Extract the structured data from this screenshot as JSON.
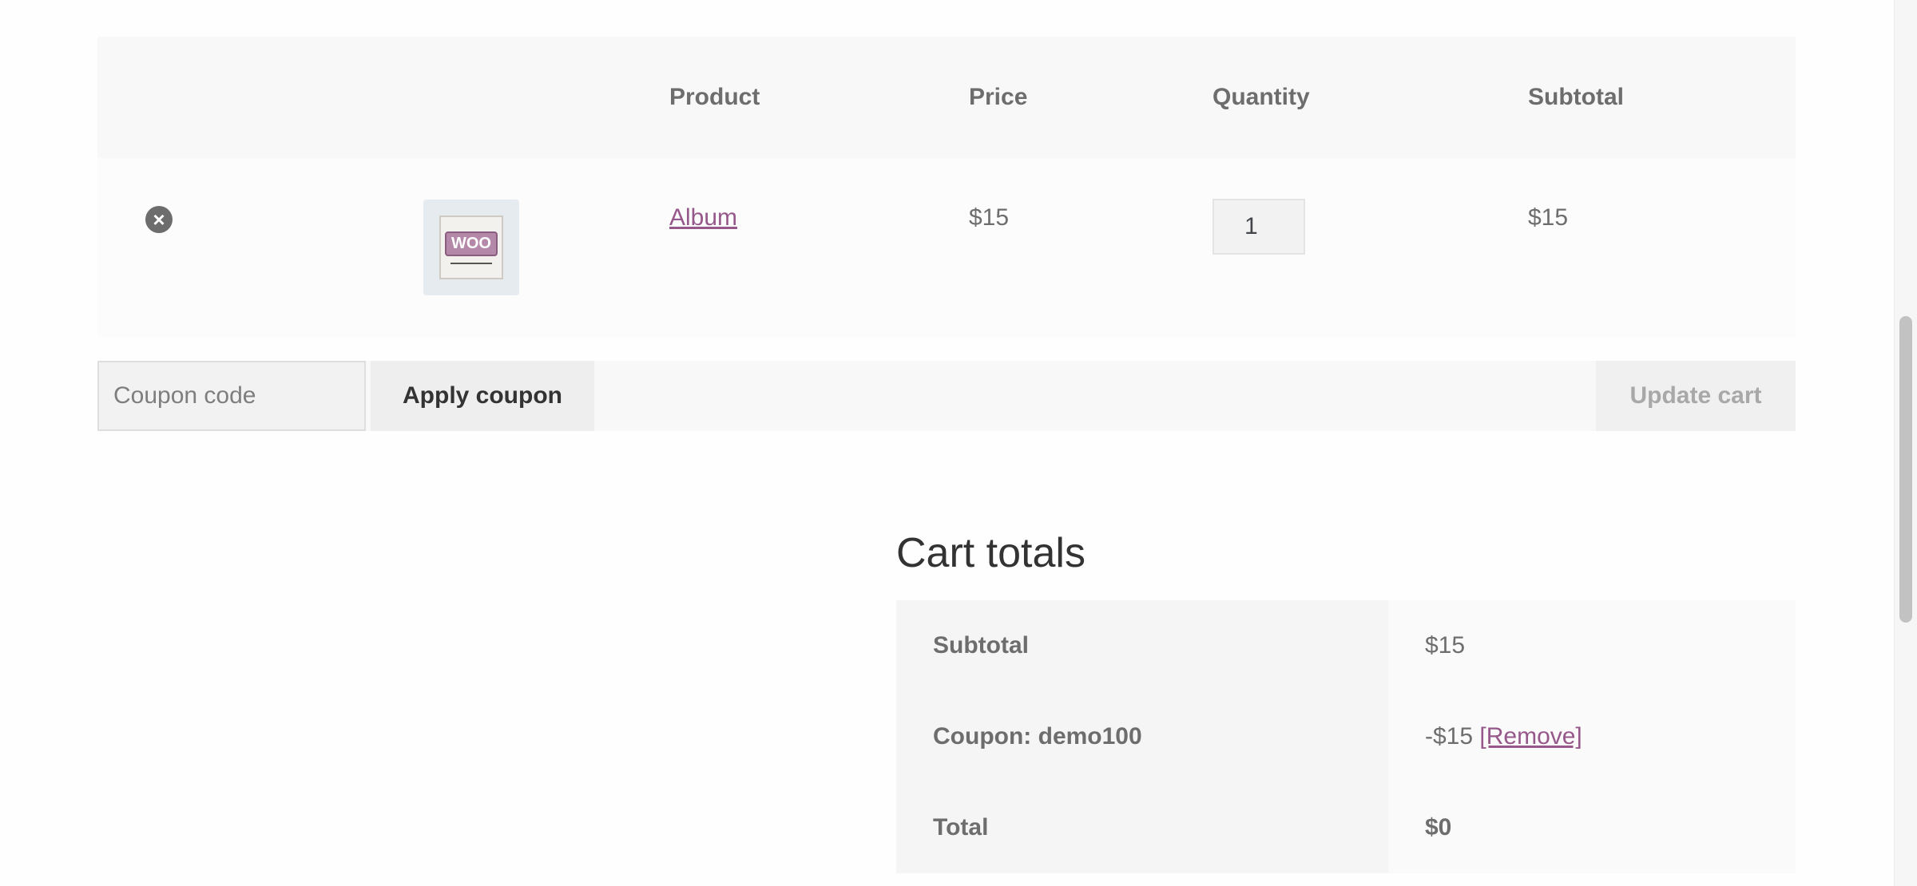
{
  "cart_table": {
    "headers": {
      "product": "Product",
      "price": "Price",
      "quantity": "Quantity",
      "subtotal": "Subtotal"
    },
    "items": [
      {
        "remove_icon": "remove-circle-x-icon",
        "remove_glyph": "×",
        "thumbnail_icon": "woo-album-thumbnail",
        "thumbnail_badge": "WOO",
        "name": "Album",
        "price": "$15",
        "quantity": "1",
        "subtotal": "$15"
      }
    ]
  },
  "actions": {
    "coupon_placeholder": "Coupon code",
    "apply_coupon_label": "Apply coupon",
    "update_cart_label": "Update cart"
  },
  "cart_totals": {
    "title": "Cart totals",
    "subtotal_label": "Subtotal",
    "subtotal_value": "$15",
    "coupon_label": "Coupon: demo100",
    "coupon_value": "-$15",
    "coupon_remove_label": "[Remove]",
    "total_label": "Total",
    "total_value": "$0"
  },
  "colors": {
    "link": "#96588a",
    "header_bg": "#f8f8f8",
    "text": "#6d6d6d",
    "heading": "#333333"
  }
}
